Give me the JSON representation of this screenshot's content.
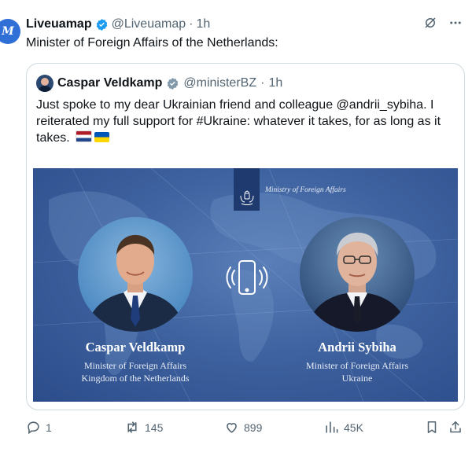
{
  "tweet": {
    "author_name": "Liveuamap",
    "author_handle": "@Liveuamap",
    "separator": "·",
    "time": "1h",
    "avatar_text": "M",
    "text": "Minister of Foreign Affairs of the Netherlands:"
  },
  "quote": {
    "author_name": "Caspar Veldkamp",
    "author_handle": "@ministerBZ",
    "separator": "·",
    "time": "1h",
    "text": "Just spoke to my dear Ukrainian friend and colleague @andrii_sybiha. I reiterated my full support for #Ukraine: whatever it takes, for as long as it takes.",
    "flags": [
      "flag-netherlands",
      "flag-ukraine"
    ]
  },
  "banner": {
    "ministry_label": "Ministry of Foreign Affairs",
    "left_person": {
      "name": "Caspar Veldkamp",
      "title_line1": "Minister of Foreign Affairs",
      "title_line2": "Kingdom of the Netherlands"
    },
    "right_person": {
      "name": "Andrii Sybiha",
      "title_line1": "Minister of Foreign Affairs",
      "title_line2": "Ukraine"
    },
    "center_icon": "phone-call-icon",
    "colors": {
      "background": "#3f63a0",
      "tab": "#1e3a6e"
    }
  },
  "actions": {
    "replies": "1",
    "reposts": "145",
    "likes": "899",
    "views": "45K"
  },
  "colors": {
    "verified": "#1d9bf0",
    "muted": "#536471",
    "border": "#cfd9de"
  }
}
